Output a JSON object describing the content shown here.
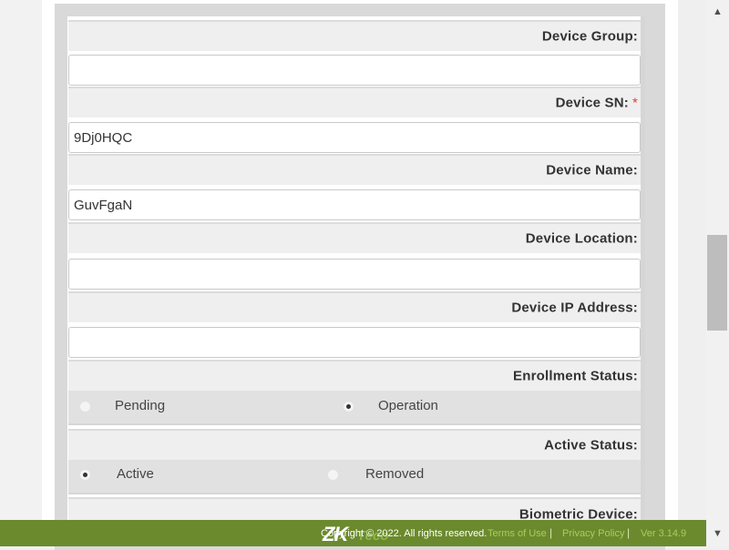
{
  "form": {
    "device_group": {
      "label": "Device Group:",
      "value": ""
    },
    "device_sn": {
      "label": "Device SN:",
      "required_mark": "*",
      "value": "9Dj0HQC"
    },
    "device_name": {
      "label": "Device Name:",
      "value": "GuvFgaN"
    },
    "device_location": {
      "label": "Device Location:",
      "value": ""
    },
    "device_ip": {
      "label": "Device IP Address:",
      "value": ""
    },
    "enrollment_status": {
      "label": "Enrollment Status:",
      "options": [
        "Pending",
        "Operation"
      ],
      "selected": "Operation"
    },
    "active_status": {
      "label": "Active Status:",
      "options": [
        "Active",
        "Removed"
      ],
      "selected": "Active"
    },
    "biometric_device": {
      "label": "Biometric Device:"
    }
  },
  "footer": {
    "logo_main": "ZK",
    "logo_sub": "Teco",
    "copyright": "Copyright © 2022. All rights reserved.",
    "terms": "Terms of Use",
    "privacy": "Privacy Policy",
    "version": "Ver 3.14.9",
    "separator": "|"
  },
  "scrollbar": {
    "up_icon": "triangle-up",
    "down_icon": "triangle-down"
  }
}
